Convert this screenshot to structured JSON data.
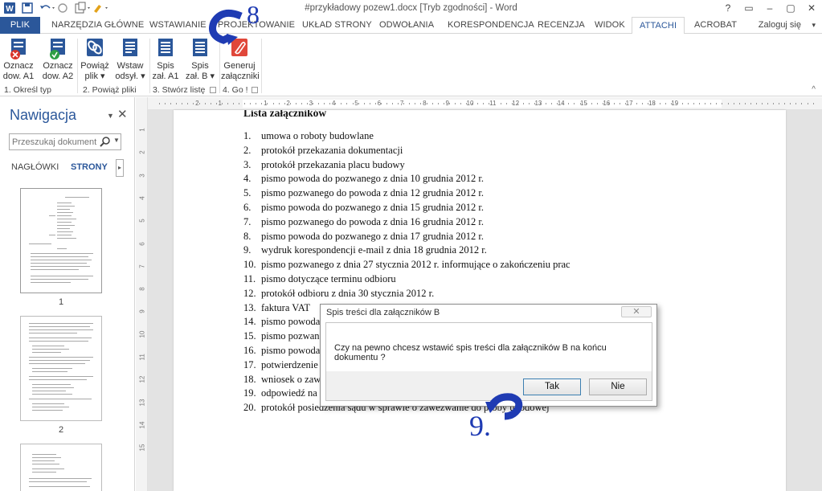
{
  "window": {
    "title": "#przykładowy pozew1.docx [Tryb zgodności] - Word",
    "controls": [
      "?",
      "▭",
      "–",
      "▢",
      "✕"
    ]
  },
  "ribbon_tabs": [
    {
      "label": "PLIK",
      "kind": "file"
    },
    {
      "label": "NARZĘDZIA GŁÓWNE"
    },
    {
      "label": "WSTAWIANIE"
    },
    {
      "label": "PROJEKTOWANIE"
    },
    {
      "label": "UKŁAD STRONY"
    },
    {
      "label": "ODWOŁANIA"
    },
    {
      "label": "KORESPONDENCJA"
    },
    {
      "label": "RECENZJA"
    },
    {
      "label": "WIDOK"
    },
    {
      "label": "ATTACHI",
      "active": true
    },
    {
      "label": "ACROBAT"
    }
  ],
  "login": "Zaloguj się",
  "ribbon": {
    "buttons": [
      {
        "line1": "Oznacz",
        "line2": "dow. A1",
        "icon": "mark-a1-icon"
      },
      {
        "line1": "Oznacz",
        "line2": "dow. A2",
        "icon": "mark-a2-icon"
      },
      {
        "line1": "Powiąż",
        "line2": "plik ▾",
        "icon": "link-file-icon"
      },
      {
        "line1": "Wstaw",
        "line2": "odsył. ▾",
        "icon": "insert-reference-icon"
      },
      {
        "line1": "Spis",
        "line2": "zał. A1",
        "icon": "list-a1-icon"
      },
      {
        "line1": "Spis",
        "line2": "zał. B ▾",
        "icon": "list-b-icon"
      },
      {
        "line1": "Generuj",
        "line2": "załączniki",
        "icon": "generate-attachments-icon"
      }
    ],
    "groups": [
      "1. Określ typ",
      "2. Powiąż pliki",
      "3. Stwórz listę",
      "4. Go !"
    ]
  },
  "nav": {
    "title": "Nawigacja",
    "search_placeholder": "Przeszukaj dokument",
    "tabs": [
      "NAGŁÓWKI",
      "STRONY"
    ],
    "pages": [
      "1",
      "2"
    ]
  },
  "ruler": {
    "h_numbers": [
      "2",
      "1",
      "1",
      "2",
      "3",
      "4",
      "5",
      "6",
      "7",
      "8",
      "9",
      "10",
      "11",
      "12",
      "13",
      "14",
      "15",
      "16",
      "17",
      "18",
      "19"
    ],
    "v_numbers": [
      "1",
      "2",
      "3",
      "4",
      "5",
      "6",
      "7",
      "8",
      "9",
      "10",
      "11",
      "12",
      "13",
      "14",
      "15"
    ]
  },
  "document": {
    "heading": "Lista załączników",
    "items": [
      {
        "n": "1.",
        "text": "umowa o roboty budowlane"
      },
      {
        "n": "2.",
        "text": "protokół przekazania dokumentacji"
      },
      {
        "n": "3.",
        "text": "protokół przekazania placu budowy"
      },
      {
        "n": "4.",
        "text": "pismo powoda do pozwanego z dnia 10 grudnia 2012 r."
      },
      {
        "n": "5.",
        "text": "pismo pozwanego do powoda z dnia 12 grudnia 2012 r."
      },
      {
        "n": "6.",
        "text": "pismo powoda do pozwanego z dnia 15 grudnia 2012 r."
      },
      {
        "n": "7.",
        "text": "pismo pozwanego do powoda z dnia 16 grudnia 2012 r."
      },
      {
        "n": "8.",
        "text": "pismo powoda do pozwanego z dnia 17 grudnia 2012 r."
      },
      {
        "n": "9.",
        "text": "wydruk korespondencji e-mail z dnia 18 grudnia 2012 r."
      },
      {
        "n": "10.",
        "text": "pismo pozwanego z dnia 27 stycznia 2012 r. informujące o zakończeniu prac"
      },
      {
        "n": "11.",
        "text": "pismo dotyczące terminu odbioru"
      },
      {
        "n": "12.",
        "text": "protokół odbioru z dnia 30 stycznia 2012 r."
      },
      {
        "n": "13.",
        "text": "faktura VAT"
      },
      {
        "n": "14.",
        "text": "pismo powoda"
      },
      {
        "n": "15.",
        "text": "pismo pozwan"
      },
      {
        "n": "16.",
        "text": "pismo powoda"
      },
      {
        "n": "17.",
        "text": "potwierdzenie"
      },
      {
        "n": "18.",
        "text": "wniosek o zaw"
      },
      {
        "n": "19.",
        "text": "odpowiedź na"
      },
      {
        "n": "20.",
        "text": "protokół posiedzenia sądu w sprawie o zawezwanie do próby ugodowej"
      }
    ]
  },
  "dialog": {
    "title": "Spis treści dla załączników B",
    "close": "✕",
    "message": "Czy na pewno chcesz wstawić spis treści dla załączników B na końcu dokumentu ?",
    "ok": "Tak",
    "cancel": "Nie"
  },
  "annotations": {
    "step8": "8",
    "step9": "9.",
    "color": "#1f3bb3"
  }
}
